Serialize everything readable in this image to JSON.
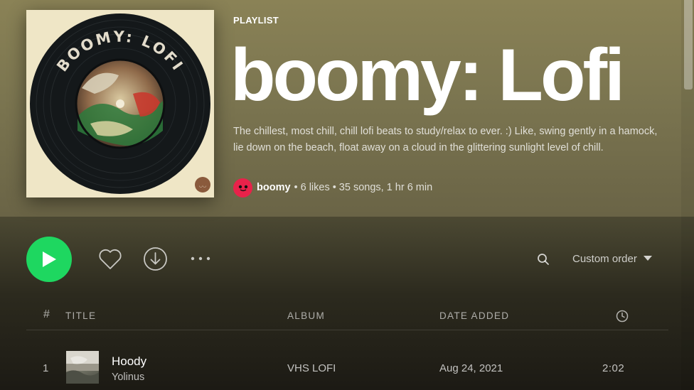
{
  "playlist": {
    "type_label": "PLAYLIST",
    "title": "boomy: Lofi",
    "description": "The chillest, most chill, chill lofi beats to study/relax to ever. :) Like, swing gently in a hamock, lie down on the beach, float away on a cloud in the glittering sunlight level of chill.",
    "owner": "boomy",
    "likes": "6 likes",
    "songs_duration": "35 songs, 1 hr 6 min",
    "separator": "•",
    "cover_text": "BOOMY: LOFI"
  },
  "actions": {
    "play_icon": "play-icon",
    "like_icon": "heart-icon",
    "download_icon": "download-icon",
    "more_icon": "more-icon",
    "search_icon": "search-icon",
    "sort_label": "Custom order",
    "sort_icon": "caret-down-icon"
  },
  "columns": {
    "number": "#",
    "title": "TITLE",
    "album": "ALBUM",
    "date_added": "DATE ADDED",
    "duration_icon": "clock-icon"
  },
  "tracks": [
    {
      "number": "1",
      "title": "Hoody",
      "artist": "Yolinus",
      "album": "VHS LOFI",
      "date_added": "Aug 24, 2021",
      "duration": "2:02"
    }
  ],
  "colors": {
    "accent": "#1ed760",
    "header_bg": "#7f7852",
    "owner_avatar": "#e8224a"
  }
}
